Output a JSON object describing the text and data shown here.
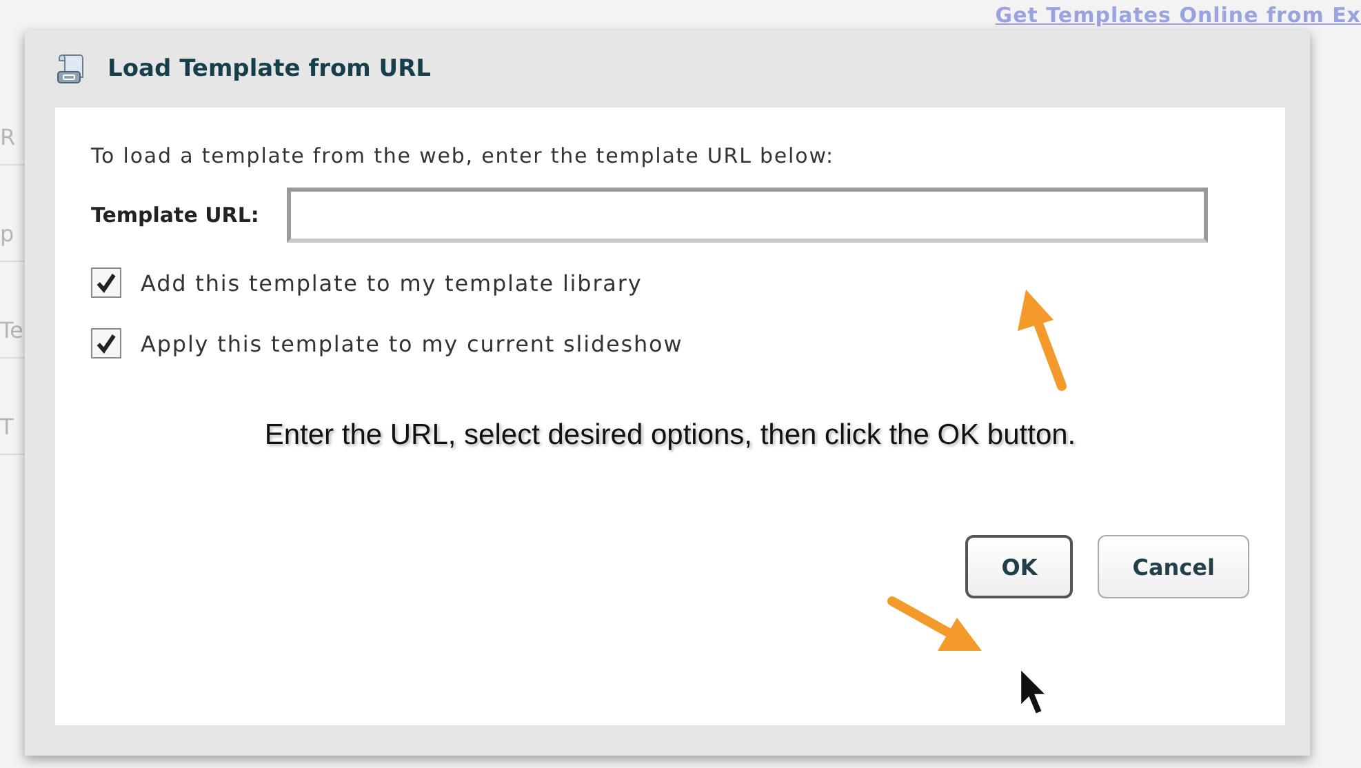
{
  "background": {
    "link": "Get Templates Online from Ex",
    "fragments": [
      "R",
      "p",
      "Te",
      "T"
    ]
  },
  "dialog": {
    "title": "Load Template from URL",
    "description": "To load a template from the web, enter the template URL below:",
    "field": {
      "label": "Template URL:"
    },
    "options": [
      {
        "label": "Add this template to my template library",
        "checked": true
      },
      {
        "label": "Apply this template to my current slideshow",
        "checked": true
      }
    ],
    "caption": "Enter the URL, select desired options, then click the OK button.",
    "buttons": [
      {
        "label": "OK",
        "focused": true
      },
      {
        "label": "Cancel",
        "focused": false
      }
    ]
  }
}
